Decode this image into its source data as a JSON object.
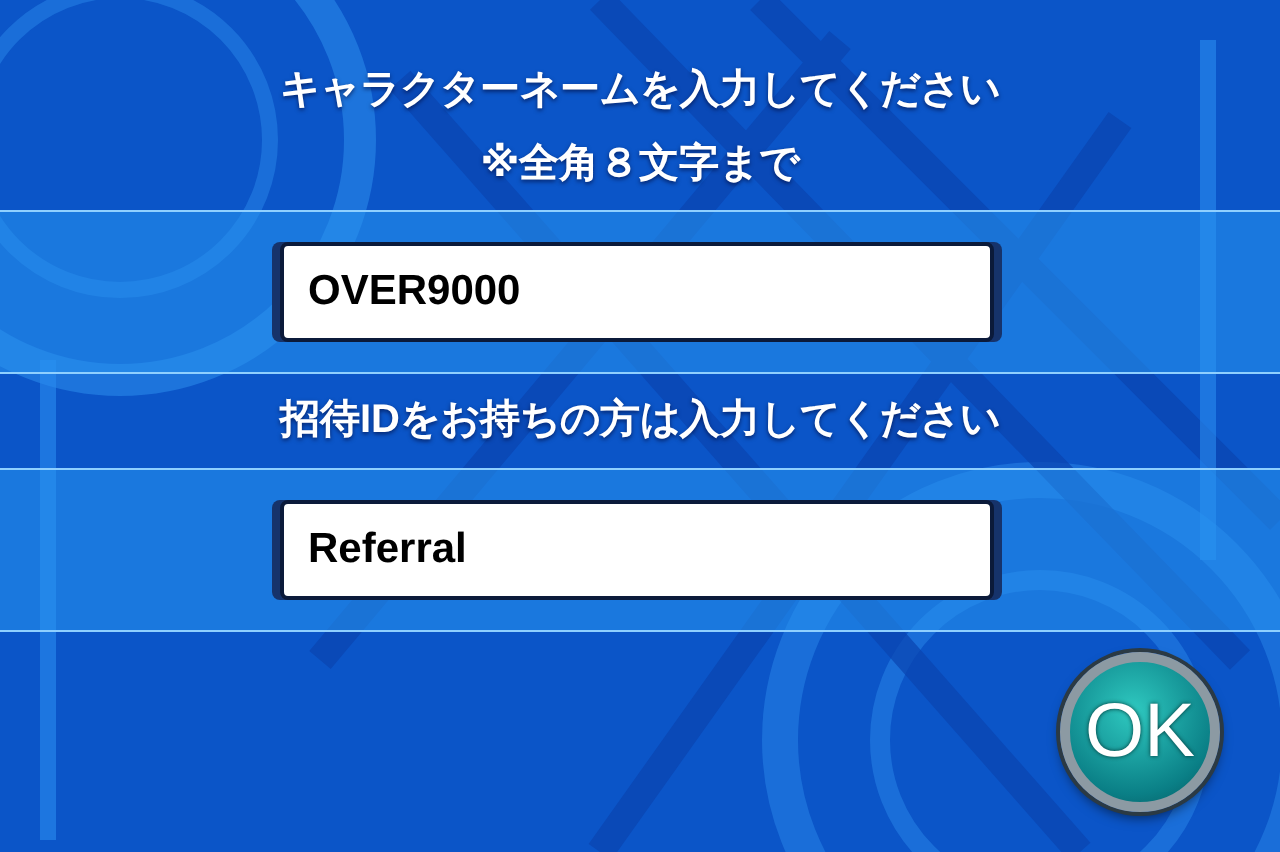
{
  "name_prompt": {
    "title": "キャラクターネームを入力してください",
    "note": "※全角８文字まで"
  },
  "name_field": {
    "value": "OVER9000"
  },
  "referral_prompt": {
    "title": "招待IDをお持ちの方は入力してください"
  },
  "referral_field": {
    "value": "Referral"
  },
  "ok_button": {
    "label": "OK"
  }
}
